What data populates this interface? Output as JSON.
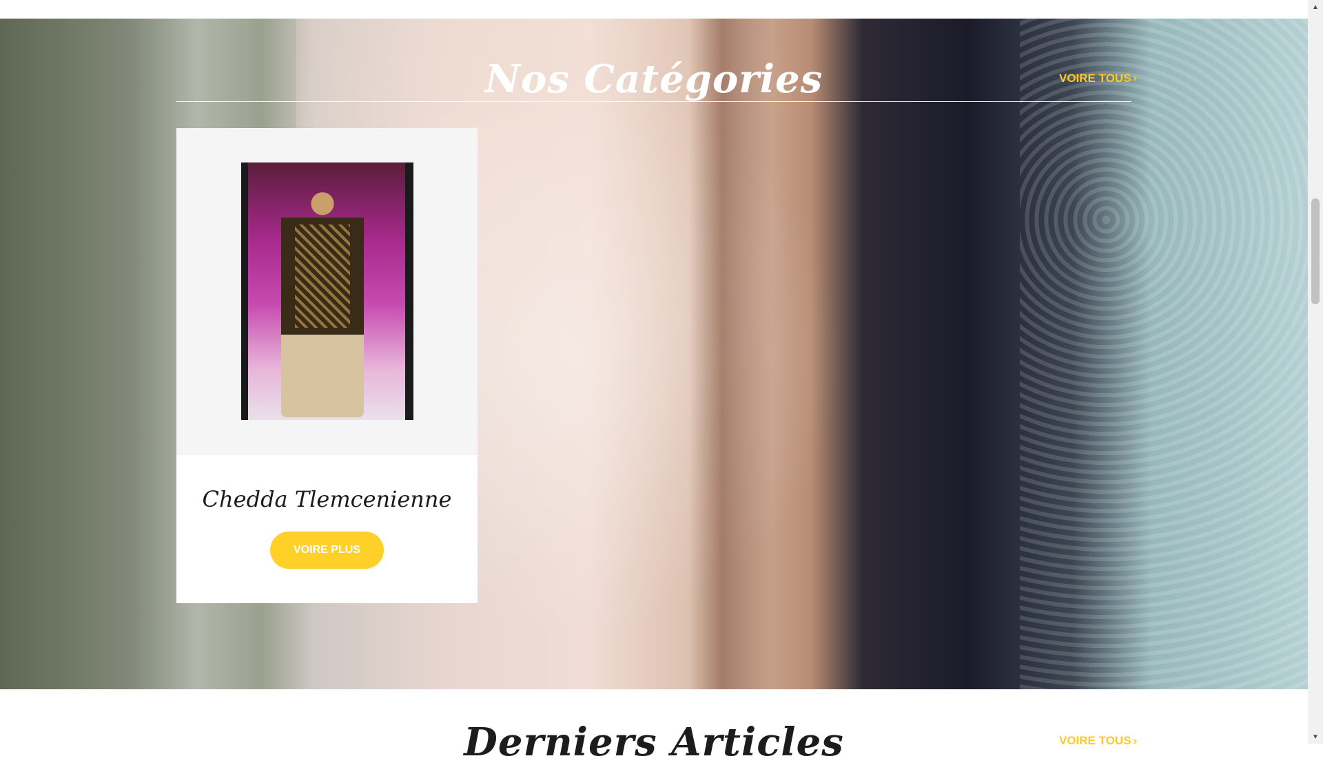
{
  "categories_section": {
    "title": "Nos Catégories",
    "view_all_label": "VOIRE TOUS",
    "view_all_icon": "chevron-right-icon",
    "items": [
      {
        "title": "Chedda Tlemcenienne",
        "button_label": "VOIRE PLUS"
      }
    ]
  },
  "articles_section": {
    "title": "Derniers Articles",
    "view_all_label": "VOIRE TOUS"
  },
  "colors": {
    "accent": "#ffc925",
    "button": "#ffd027"
  }
}
